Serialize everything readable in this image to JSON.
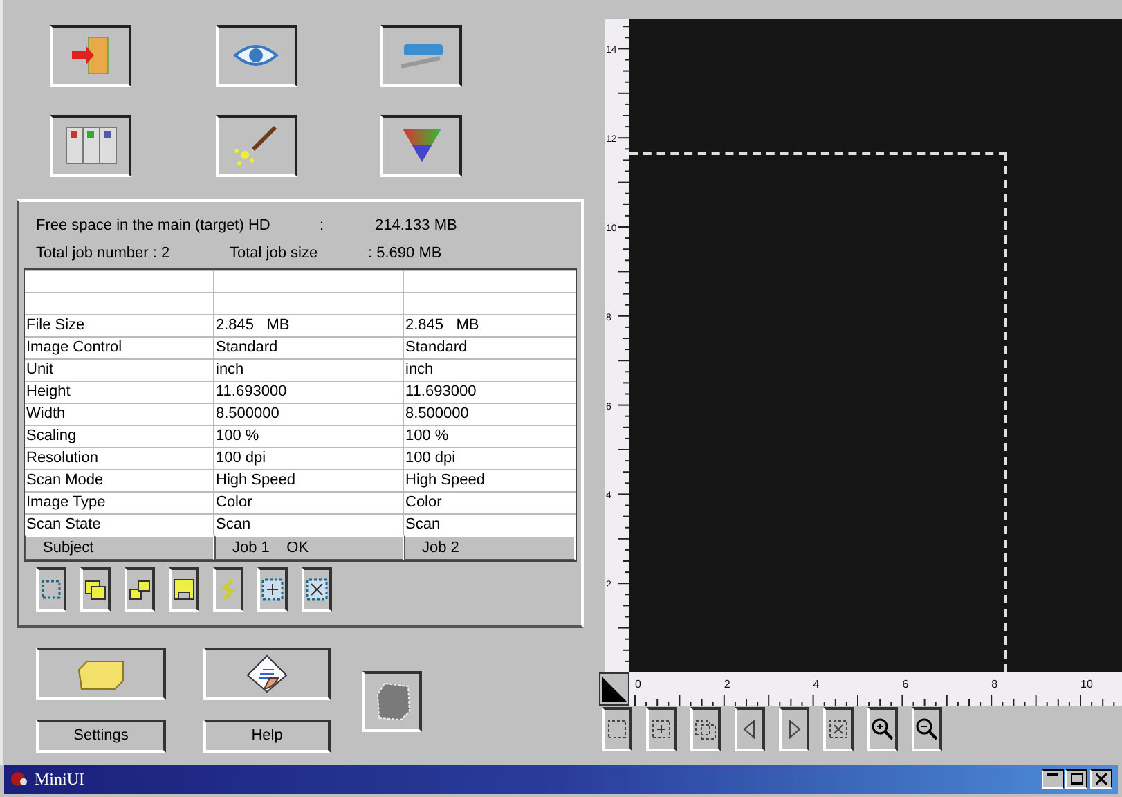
{
  "window": {
    "title": "MiniUI"
  },
  "settings_buttons": [
    {
      "label": "Settings"
    },
    {
      "label": "Help"
    }
  ],
  "table": {
    "rows": [
      {
        "kind": "data",
        "cells": [
          "File Size",
          "2.845   MB",
          "2.845   MB"
        ]
      },
      {
        "kind": "data",
        "cells": [
          "Image Control",
          "Standard",
          "Standard"
        ]
      },
      {
        "kind": "data",
        "cells": [
          "Unit",
          "inch",
          "inch"
        ]
      },
      {
        "kind": "data",
        "cells": [
          "Height",
          "11.693000",
          "11.693000"
        ]
      },
      {
        "kind": "data",
        "cells": [
          "Width",
          "8.500000",
          "8.500000"
        ]
      },
      {
        "kind": "data",
        "cells": [
          "Scaling",
          "100 %",
          "100 %"
        ]
      },
      {
        "kind": "data",
        "cells": [
          "Resolution",
          "100 dpi",
          "100 dpi"
        ]
      },
      {
        "kind": "data",
        "cells": [
          "Scan Mode",
          "High Speed",
          "High Speed"
        ]
      },
      {
        "kind": "data",
        "cells": [
          "Image Type",
          "Color",
          "Color"
        ]
      },
      {
        "kind": "data",
        "cells": [
          "Scan State",
          "Scan",
          "Scan"
        ]
      },
      {
        "kind": "heading",
        "cells": [
          "Subject",
          "Job 1    OK",
          "Job 2"
        ]
      }
    ]
  },
  "summary": {
    "job_number_label": "Total job number  :  2",
    "job_size_label": "Total job size",
    "job_size_value": ":  5.690   MB",
    "free_space_label": "Free space in the main (target) HD",
    "free_space_sep": ":",
    "free_space_value": "214.133 MB"
  },
  "ruler": {
    "x_labels": [
      "0",
      "2",
      "4",
      "6",
      "8",
      "10"
    ],
    "y_labels": [
      "14",
      "12",
      "10",
      "8",
      "6",
      "4",
      "2"
    ]
  }
}
